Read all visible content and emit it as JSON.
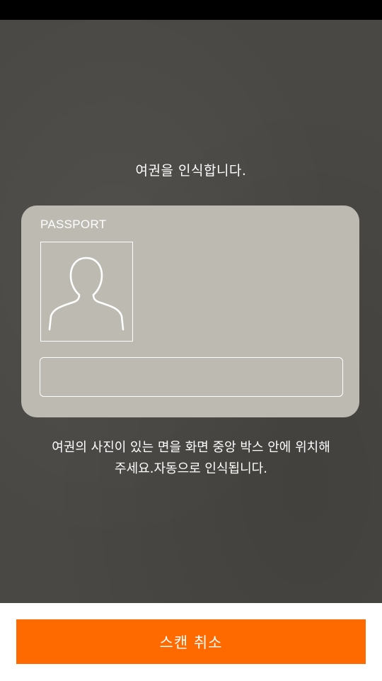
{
  "screen": {
    "title": "여권을 인식합니다.",
    "instruction_line1": "여권의 사진이 있는 면을 화면 중앙 박스 안에 위치해",
    "instruction_line2": "주세요.자동으로 인식됩니다."
  },
  "passport_frame": {
    "label": "PASSPORT",
    "photo_icon": "person-silhouette-icon"
  },
  "footer": {
    "cancel_label": "스캔 취소"
  },
  "colors": {
    "accent": "#ff6a00",
    "camera_background": "#4a4844",
    "frame_fill": "#bdbab1"
  }
}
